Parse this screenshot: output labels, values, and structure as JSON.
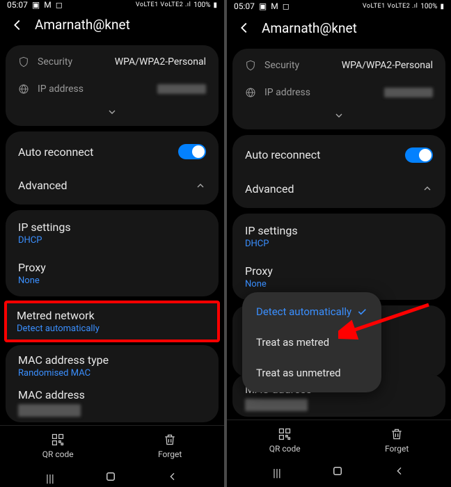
{
  "statusbar": {
    "time": "05:07",
    "indicators": "VoLTE1 VoLTE2 .ıl",
    "battery": "100%"
  },
  "header": {
    "title": "Amarnath@knet"
  },
  "security": {
    "label": "Security",
    "value": "WPA/WPA2-Personal"
  },
  "ip": {
    "label": "IP address"
  },
  "auto_reconnect": {
    "label": "Auto reconnect"
  },
  "advanced": {
    "label": "Advanced"
  },
  "ip_settings": {
    "label": "IP settings",
    "value": "DHCP"
  },
  "proxy": {
    "label": "Proxy",
    "value": "None"
  },
  "metered": {
    "label": "Metred network",
    "value": "Detect automatically"
  },
  "mac_type": {
    "label": "MAC address type",
    "value": "Randomised MAC"
  },
  "mac_addr": {
    "label": "MAC address"
  },
  "actions": {
    "qr": "QR code",
    "forget": "Forget"
  },
  "popup": {
    "opt1": "Detect automatically",
    "opt2": "Treat as metred",
    "opt3": "Treat as unmetred"
  }
}
